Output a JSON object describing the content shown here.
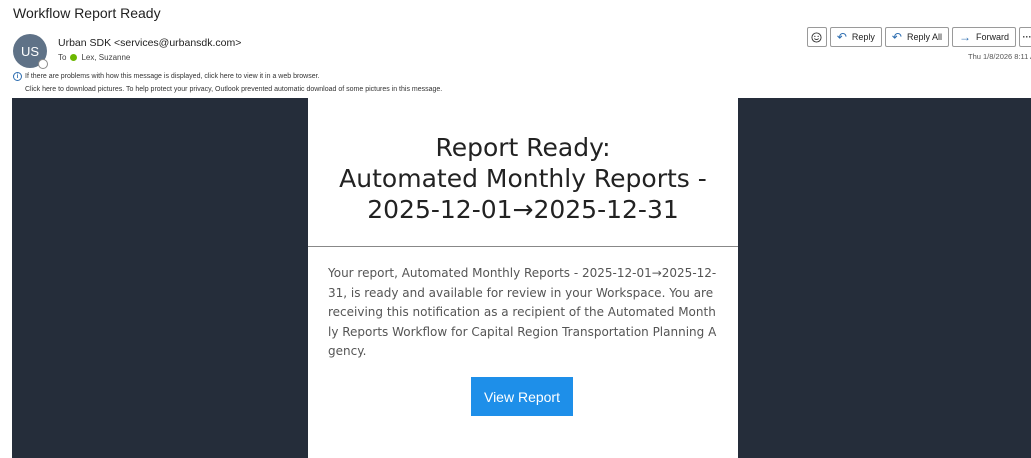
{
  "subject": "Workflow Report Ready",
  "sender": {
    "initials": "US",
    "display": "Urban SDK <services@urbansdk.com>"
  },
  "recipients": {
    "prefix": "To",
    "name": "Lex, Suzanne"
  },
  "notices": {
    "display_problem": "If there are problems with how this message is displayed, click here to view it in a web browser.",
    "pictures": "Click here to download pictures. To help protect your privacy, Outlook prevented automatic download of some pictures in this message."
  },
  "actions": {
    "reply": "Reply",
    "reply_all": "Reply All",
    "forward": "Forward",
    "more": "···"
  },
  "received": "Thu 1/8/2026 8:11 A",
  "message": {
    "title_lines": [
      "Report Ready:",
      "Automated Monthly Reports -",
      "2025-12-01→2025-12-31"
    ],
    "body": "Your report, Automated Monthly Reports - 2025-12-01→2025-12-31, is ready and available for review in your Workspace. You are receiving this notification as a recipient of the Automated Monthly Reports Workflow for Capital Region Transportation Planning Agency.",
    "button": "View Report"
  },
  "colors": {
    "body_background": "#252d3a",
    "button": "#1e8fe9",
    "presence": "#6bb700",
    "avatar": "#5f7287"
  }
}
